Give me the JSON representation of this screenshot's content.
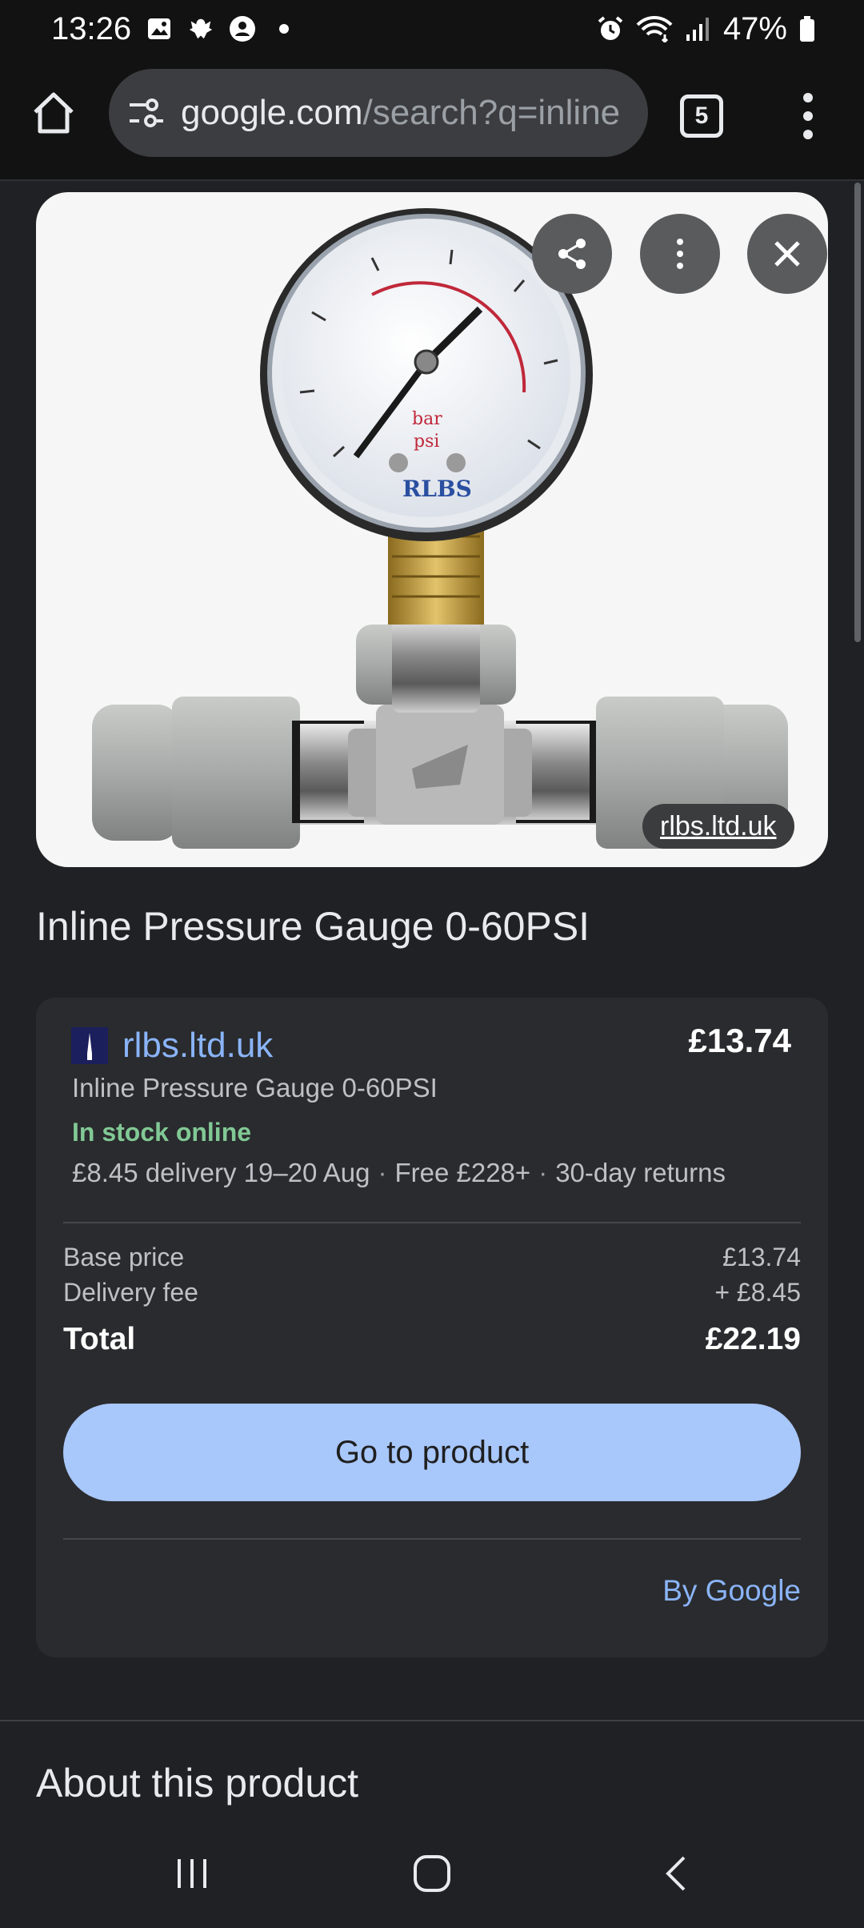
{
  "status_bar": {
    "time": "13:26",
    "battery": "47%",
    "icons": [
      "gallery-icon",
      "bird-icon",
      "account-icon",
      "dot-icon",
      "alarm-icon",
      "wifi-icon",
      "signal-icon",
      "battery-icon"
    ]
  },
  "browser": {
    "url_host": "google.com",
    "url_rest": "/search?q=inline",
    "tab_count": "5"
  },
  "image": {
    "source": "rlbs.ltd.uk",
    "gauge_unit_bar": "bar",
    "gauge_unit_psi": "psi",
    "gauge_brand": "RLBS"
  },
  "product": {
    "title": "Inline Pressure Gauge 0-60PSI"
  },
  "offer": {
    "merchant": "rlbs.ltd.uk",
    "price": "£13.74",
    "title": "Inline Pressure Gauge 0-60PSI",
    "stock": "In stock online",
    "delivery": "£8.45 delivery 19–20 Aug",
    "free_threshold": "Free £228+",
    "returns": "30-day returns",
    "separator": "·",
    "base_price_label": "Base price",
    "base_price_value": "£13.74",
    "delivery_fee_label": "Delivery fee",
    "delivery_fee_value": "+ £8.45",
    "total_label": "Total",
    "total_value": "£22.19",
    "cta": "Go to product",
    "attribution": "By Google"
  },
  "about": {
    "heading": "About this product"
  },
  "colors": {
    "background": "#202124",
    "link": "#8ab4f8",
    "stock_green": "#81c995",
    "cta_blue": "#a8c7fa"
  }
}
